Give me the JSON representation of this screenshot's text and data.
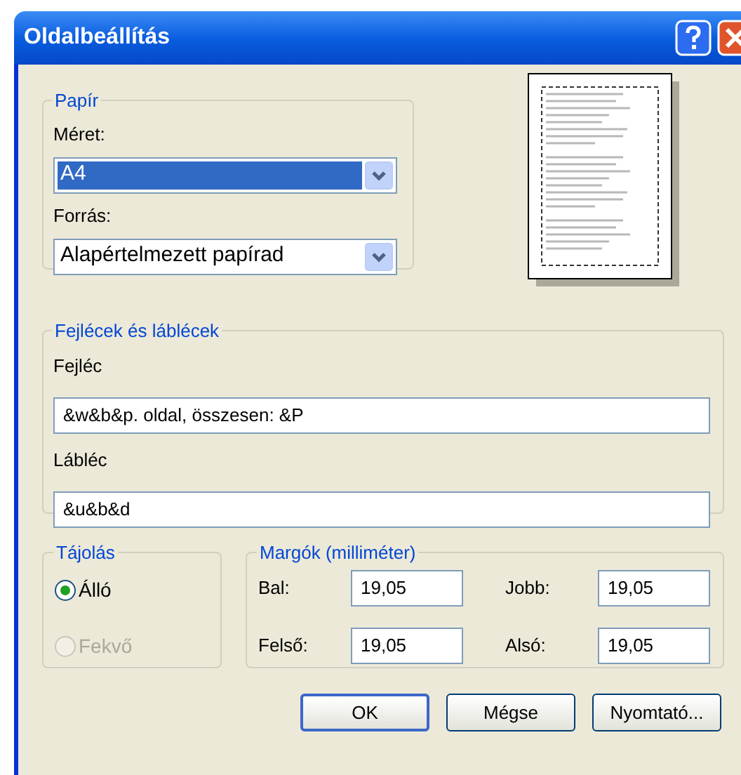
{
  "window": {
    "title": "Oldalbeállítás"
  },
  "paper": {
    "legend": "Papír",
    "fields": [
      {
        "label": "Méret:",
        "value": "A4",
        "focused": true
      },
      {
        "label": "Forrás:",
        "value": "Alapértelmezett papírad",
        "focused": false
      }
    ]
  },
  "headers_footers": {
    "legend": "Fejlécek és láblécek",
    "fields": [
      {
        "label": "Fejléc",
        "value": "&w&b&p. oldal, összesen: &P"
      },
      {
        "label": "Lábléc",
        "value": "&u&b&d"
      }
    ]
  },
  "orientation": {
    "legend": "Tájolás",
    "options": [
      {
        "label": "Álló",
        "selected": true,
        "disabled": false
      },
      {
        "label": "Fekvő",
        "selected": false,
        "disabled": true
      }
    ]
  },
  "margins": {
    "legend": "Margók (milliméter)",
    "fields": [
      {
        "label": "Bal:",
        "value": "19,05"
      },
      {
        "label": "Jobb:",
        "value": "19,05"
      },
      {
        "label": "Felső:",
        "value": "19,05"
      },
      {
        "label": "Alsó:",
        "value": "19,05"
      }
    ]
  },
  "buttons": [
    {
      "label": "OK",
      "default": true
    },
    {
      "label": "Mégse",
      "default": false
    },
    {
      "label": "Nyomtató...",
      "default": false
    }
  ]
}
